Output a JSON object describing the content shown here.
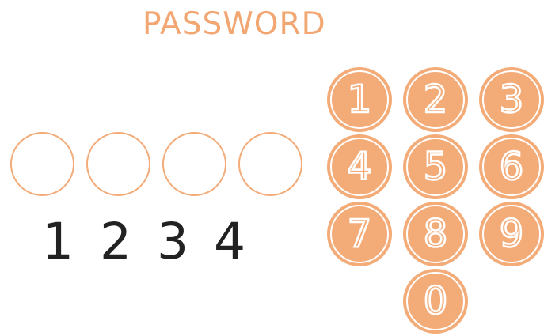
{
  "title": "PASSWORD",
  "entered_digits": [
    "1",
    "2",
    "3",
    "4"
  ],
  "keypad": {
    "keys": [
      "1",
      "2",
      "3",
      "4",
      "5",
      "6",
      "7",
      "8",
      "9",
      "0"
    ]
  },
  "colors": {
    "accent": "#f3ab78",
    "title": "#f2a672",
    "digit_text": "#222222"
  }
}
